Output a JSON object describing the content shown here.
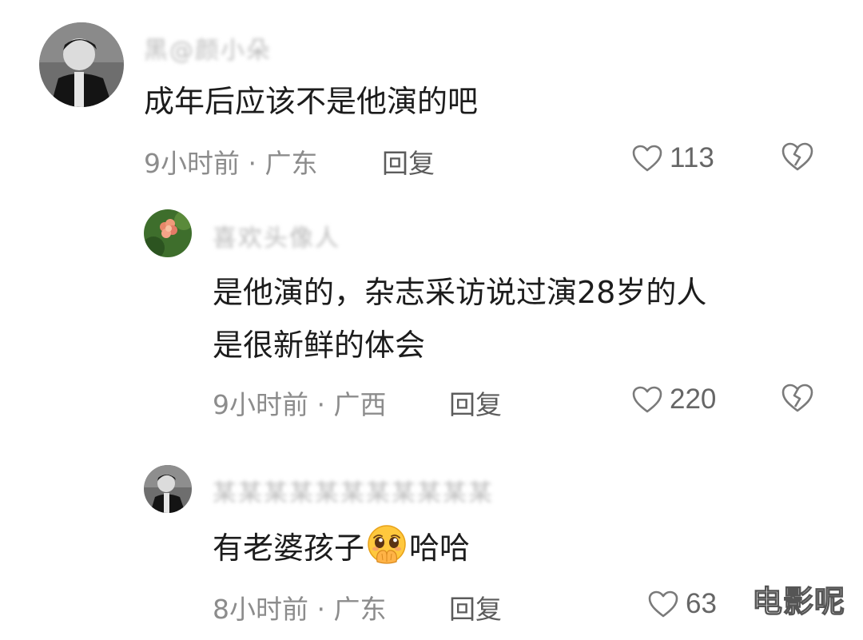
{
  "comments": [
    {
      "username": "黑@颜小朵",
      "text_lines": [
        "成年后应该不是他演的吧"
      ],
      "time": "9小时前",
      "location": "广东",
      "reply_label": "回复",
      "likes": "113",
      "avatar": "person-photo-bw"
    },
    {
      "username": "喜欢头像人",
      "text_lines": [
        "是他演的，杂志采访说过演28岁的人",
        "是很新鲜的体会"
      ],
      "time": "9小时前",
      "location": "广西",
      "reply_label": "回复",
      "likes": "220",
      "avatar": "flower-photo"
    },
    {
      "username": "某某某某某某某某某某某",
      "text_before_emoji": "有老婆孩子",
      "emoji": "pleading-face-hands-emoji",
      "text_after_emoji": "哈哈",
      "time": "8小时前",
      "location": "广东",
      "reply_label": "回复",
      "likes": "63",
      "avatar": "person-photo-bw"
    }
  ],
  "separator": "·",
  "watermark": "电影呢",
  "colors": {
    "meta": "#8c8c8c",
    "text": "#1c1c1c",
    "username_blurred": "#bcbcbc"
  }
}
